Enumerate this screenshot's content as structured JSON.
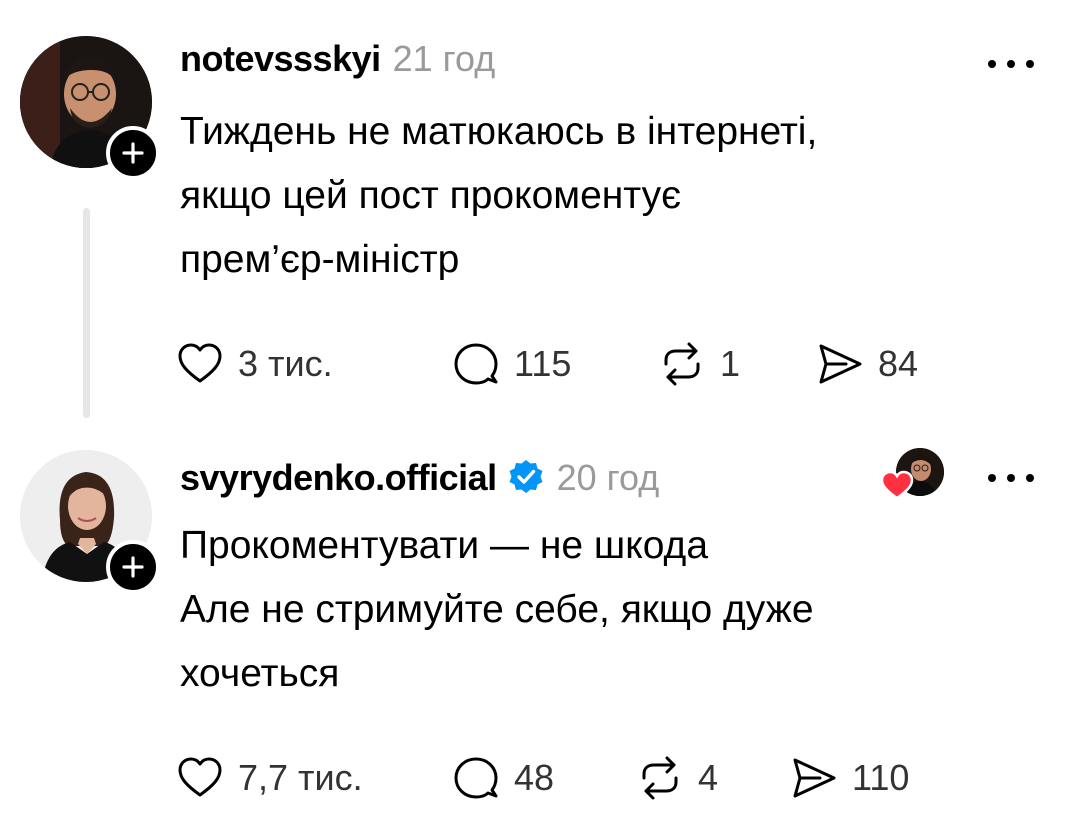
{
  "posts": [
    {
      "username": "notevssskyi",
      "time": "21 год",
      "text_lines": [
        "Тиждень не матюкаюсь в інтернеті,",
        "якщо цей пост прокоментує",
        "прем’єр-міністр"
      ],
      "likes": "3 тис.",
      "comments": "115",
      "reposts": "1",
      "shares": "84"
    },
    {
      "username": "svyrydenko.official",
      "verified": true,
      "time": "20 год",
      "text_lines": [
        "Прокоментувати — не шкода",
        "Але не стримуйте себе, якщо дуже",
        "хочеться"
      ],
      "likes": "7,7 тис.",
      "comments": "48",
      "reposts": "4",
      "shares": "110"
    }
  ],
  "icons": {
    "like": "heart-outline-icon",
    "comment": "speech-bubble-icon",
    "repost": "repost-arrows-icon",
    "share": "send-icon",
    "more": "more-dots-icon",
    "follow": "plus-icon",
    "verified": "verified-badge-icon"
  },
  "colors": {
    "verified": "#0095f6",
    "liked_heart": "#ff3040",
    "thread_line": "#e6e6e6",
    "muted_text": "#9a9a9a"
  }
}
